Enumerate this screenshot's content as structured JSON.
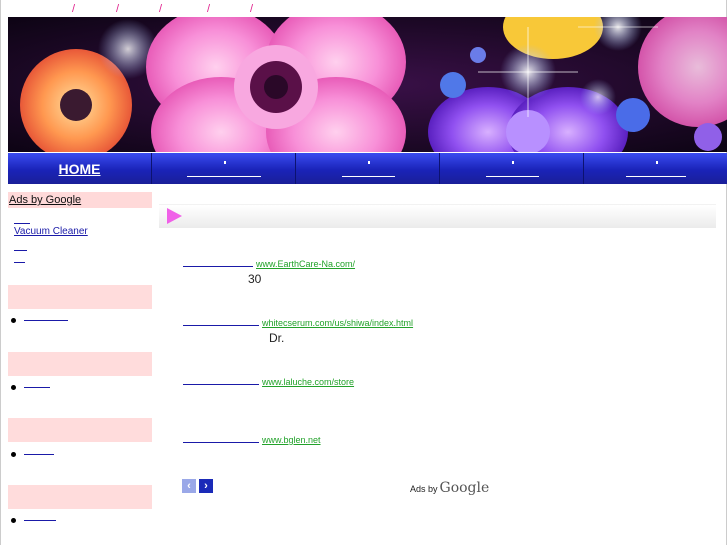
{
  "topbar": {
    "separators": [
      "/",
      "/",
      "/",
      "/",
      "/"
    ]
  },
  "banner": {
    "alt": ""
  },
  "nav": {
    "home_label": "HOME"
  },
  "sidebar": {
    "ads_heading": "Ads by Google",
    "ad_link_1": "Vacuum Cleaner"
  },
  "ads": [
    {
      "url": "www.EarthCare-Na.com/",
      "desc": "30"
    },
    {
      "url": "whitecserum.com/us/shiwa/index.html",
      "desc": "Dr."
    },
    {
      "url": "www.laluche.com/store",
      "desc": ""
    },
    {
      "url": "www.bglen.net",
      "desc": ""
    }
  ],
  "pager": {
    "prev": "‹",
    "next": "›"
  },
  "ads_by_google": {
    "prefix": "Ads by",
    "brand": "Google"
  },
  "colors": {
    "accent_pink": "#f060e8",
    "nav_blue": "#1a23b8",
    "url_green": "#22a22a",
    "link_blue": "#1a1aa8"
  }
}
